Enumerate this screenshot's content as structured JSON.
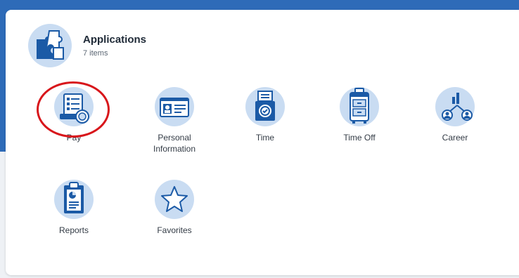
{
  "colors": {
    "brand_blue": "#2e6bb8",
    "icon_bg": "#c9dcf2",
    "icon_dark": "#1b5aa6",
    "annotation_red": "#d8161b"
  },
  "card": {
    "title": "Applications",
    "subtitle": "7 items",
    "icon": "puzzle-icon"
  },
  "apps": [
    {
      "label": "Pay",
      "icon": "pay-icon"
    },
    {
      "label": "Personal\nInformation",
      "icon": "id-card-icon"
    },
    {
      "label": "Time",
      "icon": "time-clock-icon"
    },
    {
      "label": "Time Off",
      "icon": "suitcase-icon"
    },
    {
      "label": "Career",
      "icon": "career-icon"
    },
    {
      "label": "Reports",
      "icon": "clipboard-report-icon"
    },
    {
      "label": "Favorites",
      "icon": "star-icon"
    }
  ],
  "annotation": {
    "target": "Pay"
  }
}
